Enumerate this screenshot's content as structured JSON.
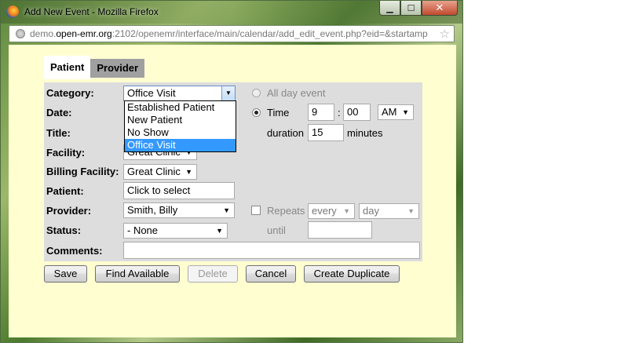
{
  "window": {
    "title": "Add New Event - Mozilla Firefox",
    "url_prefix": "demo.",
    "url_domain": "open-emr.org",
    "url_rest": ":2102/openemr/interface/main/calendar/add_edit_event.php?eid=&startamp",
    "controls": {
      "min": "▁",
      "max": "☐",
      "close": "✕"
    }
  },
  "tabs": [
    {
      "label": "Patient",
      "active": true
    },
    {
      "label": "Provider",
      "active": false
    }
  ],
  "form": {
    "category_label": "Category:",
    "category_value": "Office Visit",
    "category_options": [
      "Established Patient",
      "New Patient",
      "No Show",
      "Office Visit"
    ],
    "date_label": "Date:",
    "title_label": "Title:",
    "facility_label": "Facility:",
    "facility_value": "Great Clinic",
    "billing_label": "Billing Facility:",
    "billing_value": "Great Clinic",
    "patient_label": "Patient:",
    "patient_value": "Click to select",
    "provider_label": "Provider:",
    "provider_value": "Smith, Billy",
    "status_label": "Status:",
    "status_value": "- None",
    "comments_label": "Comments:",
    "allday_label": "All day event",
    "time_label": "Time",
    "hour": "9",
    "colon": ":",
    "minute": "00",
    "ampm": "AM",
    "duration_label": "duration",
    "duration_value": "15",
    "minutes_label": "minutes",
    "repeats_label": "Repeats",
    "repeat_every": "every",
    "repeat_unit": "day",
    "until_label": "until"
  },
  "buttons": {
    "save": "Save",
    "find": "Find Available",
    "delete": "Delete",
    "cancel": "Cancel",
    "duplicate": "Create Duplicate"
  }
}
